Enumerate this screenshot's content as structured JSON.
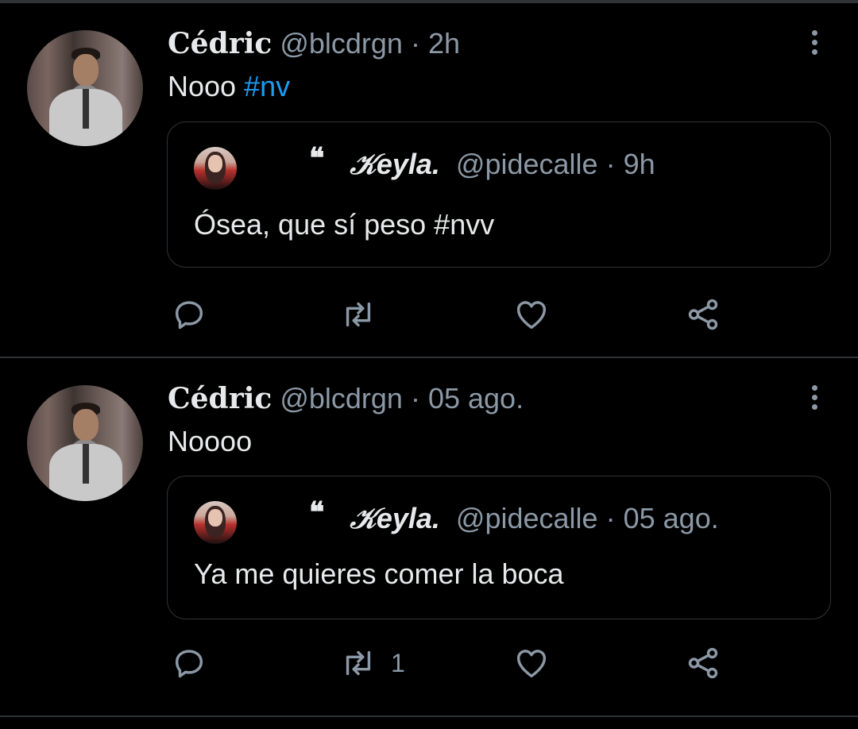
{
  "tweets": [
    {
      "name": "Cédric",
      "handle": "@blcdrgn",
      "separator": "·",
      "time": "2h",
      "text": "Nooo",
      "hashtag": "#nv",
      "quote": {
        "quote_glyph": "❝",
        "name": "𝒦eyla.",
        "handle": "@pidecalle",
        "separator": "·",
        "time": "9h",
        "text": "Ósea, que sí peso #nvv"
      },
      "retweet_count": ""
    },
    {
      "name": "Cédric",
      "handle": "@blcdrgn",
      "separator": "·",
      "time": "05 ago.",
      "text": "Noooo",
      "hashtag": "",
      "quote": {
        "quote_glyph": "❝",
        "name": "𝒦eyla.",
        "handle": "@pidecalle",
        "separator": "·",
        "time": "05 ago.",
        "text": "Ya me quieres comer la boca"
      },
      "retweet_count": "1"
    }
  ],
  "icons": [
    "reply-icon",
    "retweet-icon",
    "like-icon",
    "share-icon",
    "more-options-icon"
  ],
  "colors": {
    "background": "#000000",
    "text": "#e7e9ea",
    "secondary": "#8b98a5",
    "hashtag": "#1d9bf0",
    "border": "#2f3336"
  }
}
